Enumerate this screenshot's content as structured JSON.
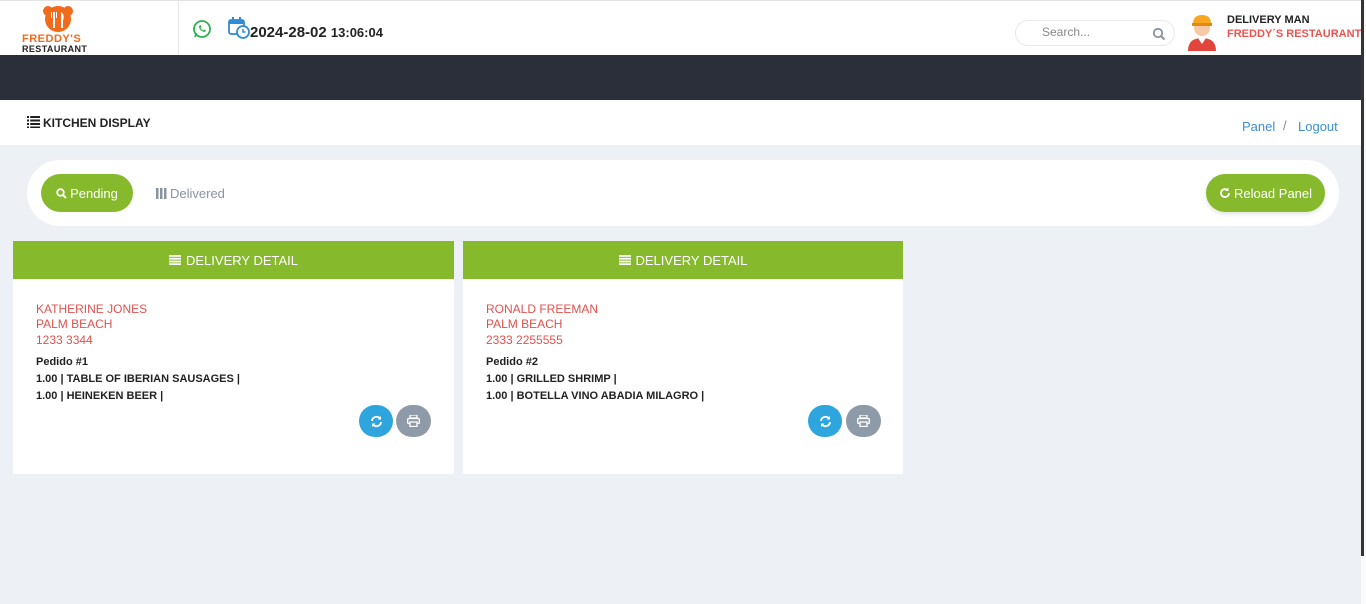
{
  "brand": {
    "name_line1": "FREDDY'S",
    "name_line2": "RESTAURANT",
    "primary_color": "#86b92c",
    "accent_color": "#f26a1b"
  },
  "header": {
    "whatsapp_icon": "whatsapp-icon",
    "calendar_icon": "calendar-clock-icon",
    "date": "2024-28-02",
    "time": "13:06:04",
    "search": {
      "placeholder": "Search...",
      "value": ""
    },
    "user": {
      "role": "DELIVERY MAN",
      "company": "FREDDY´S RESTAURANT"
    }
  },
  "page": {
    "title": "KITCHEN DISPLAY",
    "breadcrumb": {
      "panel": "Panel",
      "separator": "/",
      "logout": "Logout"
    }
  },
  "tabs": {
    "pending": "Pending",
    "delivered": "Delivered",
    "reload": "Reload Panel"
  },
  "cards": [
    {
      "header": "DELIVERY DETAIL",
      "customer": "KATHERINE JONES",
      "city": "PALM BEACH",
      "phone": "1233 3344",
      "order": "Pedido #1",
      "items": [
        "1.00 | TABLE OF IBERIAN SAUSAGES |",
        "1.00 | HEINEKEN BEER |"
      ]
    },
    {
      "header": "DELIVERY DETAIL",
      "customer": "RONALD FREEMAN",
      "city": "PALM BEACH",
      "phone": "2333 2255555",
      "order": "Pedido #2",
      "items": [
        "1.00 | GRILLED SHRIMP |",
        "1.00 | BOTELLA VINO ABADIA MILAGRO |"
      ]
    }
  ]
}
